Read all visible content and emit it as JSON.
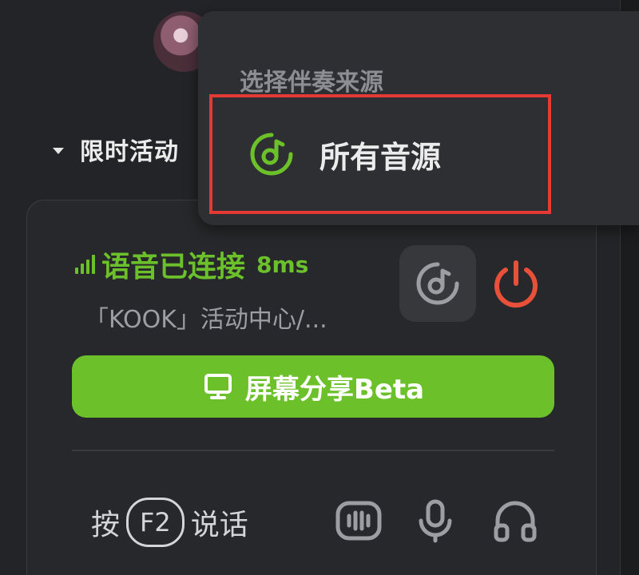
{
  "sidebar": {
    "section_title": "限时活动"
  },
  "voice": {
    "status": "语音已连接",
    "latency": "8ms",
    "channel": "「KOOK」活动中心/...",
    "share_button": "屏幕分享Beta",
    "ptt": {
      "prefix": "按",
      "key": "F2",
      "suffix": "说话"
    }
  },
  "dropdown": {
    "title": "选择伴奏来源",
    "items": [
      {
        "label": "所有音源"
      }
    ]
  },
  "colors": {
    "accent": "#6cc12b",
    "disconnect": "#e8503a",
    "highlight_border": "#e53935"
  },
  "icons": [
    "signal-icon",
    "music-source-icon",
    "power-icon",
    "monitor-icon",
    "noise-suppression-icon",
    "microphone-icon",
    "headphones-icon"
  ]
}
